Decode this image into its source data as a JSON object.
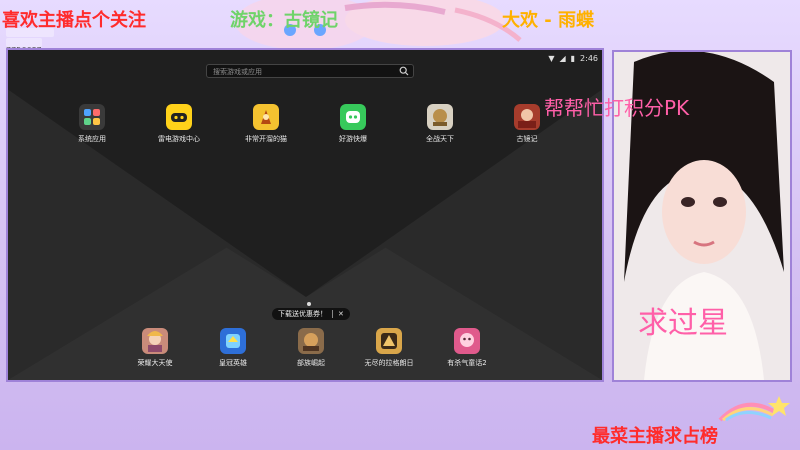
{
  "overlay": {
    "follow_text": "喜欢主播点个关注",
    "game_text": "游戏：古镜记",
    "streamer_text": "大欢 - 雨蝶",
    "rank_text": "最菜主播求占榜",
    "id_value": "7756687"
  },
  "emulator": {
    "status": {
      "time": "2:46"
    },
    "search_placeholder": "搜索游戏或应用",
    "apps_top": [
      {
        "label": "系统应用"
      },
      {
        "label": "雷电游戏中心"
      },
      {
        "label": "非常开溜的猫"
      },
      {
        "label": "好游快爆"
      },
      {
        "label": "全战天下"
      },
      {
        "label": "古镜记"
      }
    ],
    "toast_text": "下载送优惠券！",
    "apps_bottom": [
      {
        "label": "荣耀大天使"
      },
      {
        "label": "皇冠英雄"
      },
      {
        "label": "部族崛起"
      },
      {
        "label": "无尽的拉格朗日"
      },
      {
        "label": "有杀气童话2"
      }
    ]
  },
  "camera": {
    "pk_text": "帮帮忙打积分PK",
    "star_text": "求过星"
  },
  "colors": {
    "accent_red": "#ff2c2c",
    "accent_green": "#6fd36a",
    "accent_orange": "#ffb100",
    "accent_pink": "#ff5fa8",
    "frame": "#9f82d8"
  }
}
